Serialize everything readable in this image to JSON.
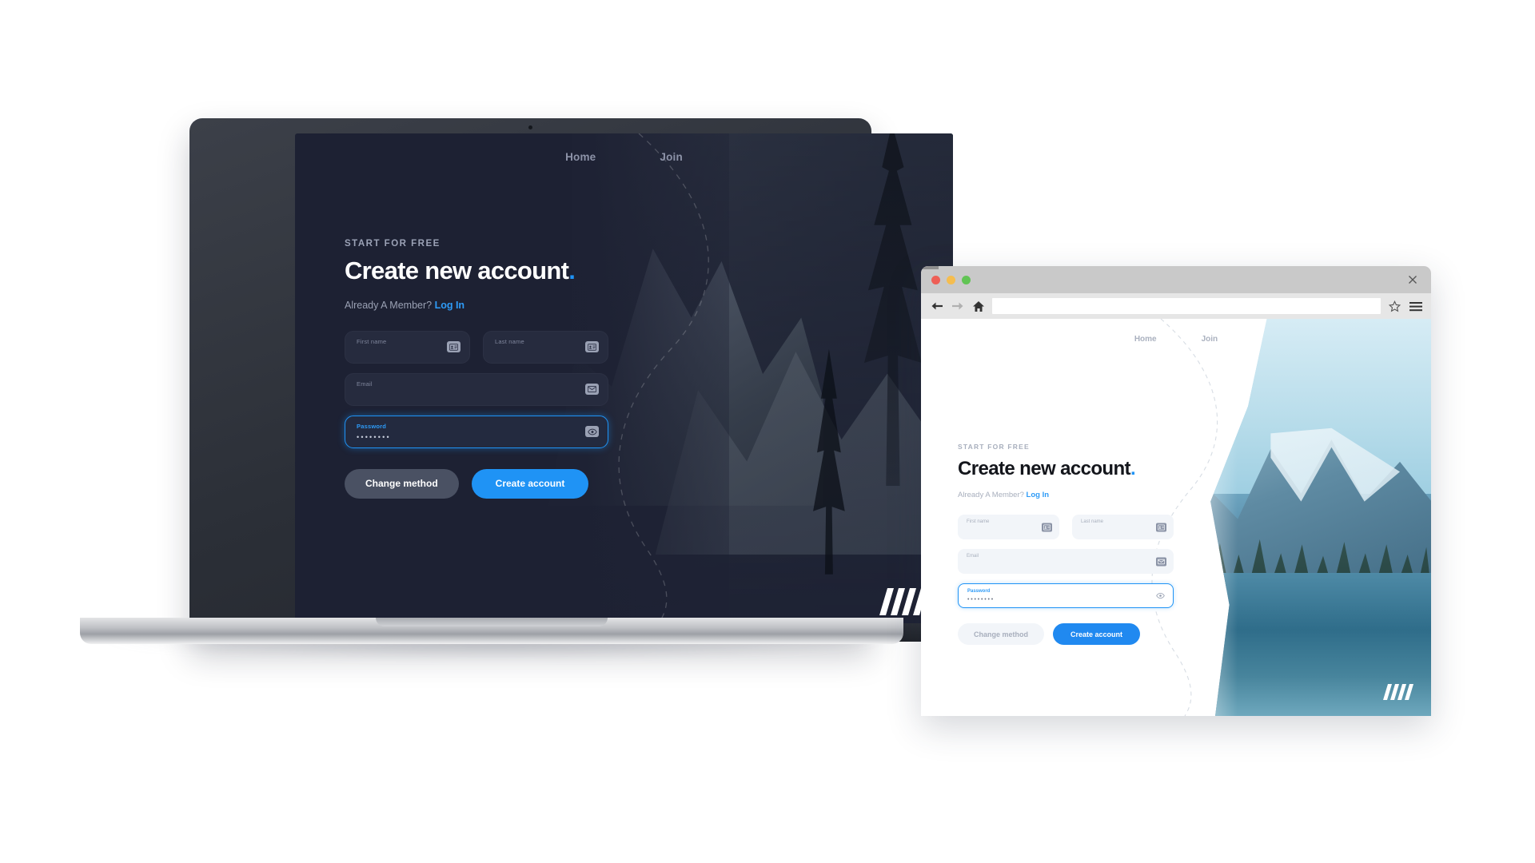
{
  "laptop_page": {
    "nav": [
      {
        "label": "Home"
      },
      {
        "label": "Join"
      }
    ],
    "eyebrow": "START FOR FREE",
    "heading": "Create new account",
    "heading_dot": ".",
    "subtext_prefix": "Already A Member?",
    "login_link": "Log In",
    "fields": {
      "first_name": {
        "label": "First name",
        "value": "",
        "icon": "contact-card-icon"
      },
      "last_name": {
        "label": "Last name",
        "value": "",
        "icon": "contact-card-icon"
      },
      "email": {
        "label": "Email",
        "value": "",
        "icon": "envelope-icon"
      },
      "password": {
        "label": "Password",
        "value": "••••••••",
        "icon": "eye-icon",
        "focused": true
      }
    },
    "buttons": {
      "secondary": "Change method",
      "primary": "Create account"
    },
    "colors": {
      "background": "#1d2133",
      "field": "#262b3e",
      "accent": "#1f93f5",
      "secondary_button": "#4a5163",
      "heading": "#ffffff",
      "muted_text": "#9aa1b4"
    }
  },
  "browser": {
    "window_controls": {
      "close_dot": "close-traffic-light",
      "minimize_dot": "minimize-traffic-light",
      "maximize_dot": "maximize-traffic-light",
      "close_button": "close-icon"
    },
    "toolbar": {
      "back": "back-arrow-icon",
      "forward": "forward-arrow-icon",
      "home": "home-icon",
      "url_value": "",
      "url_placeholder": "",
      "bookmark": "star-icon",
      "menu": "hamburger-menu-icon"
    },
    "page": {
      "nav": [
        {
          "label": "Home"
        },
        {
          "label": "Join"
        }
      ],
      "eyebrow": "START FOR FREE",
      "heading": "Create new account",
      "heading_dot": ".",
      "subtext_prefix": "Already A Member?",
      "login_link": "Log In",
      "fields": {
        "first_name": {
          "label": "First name",
          "value": "",
          "icon": "contact-card-icon"
        },
        "last_name": {
          "label": "Last name",
          "value": "",
          "icon": "contact-card-icon"
        },
        "email": {
          "label": "Email",
          "value": "",
          "icon": "envelope-icon"
        },
        "password": {
          "label": "Password",
          "value": "••••••••",
          "icon": "eye-icon",
          "focused": true
        }
      },
      "buttons": {
        "secondary": "Change method",
        "primary": "Create account"
      },
      "colors": {
        "background": "#ffffff",
        "field": "#f2f5f9",
        "accent": "#2089f0",
        "heading": "#14161c",
        "muted_text": "#a8afbd"
      }
    }
  }
}
